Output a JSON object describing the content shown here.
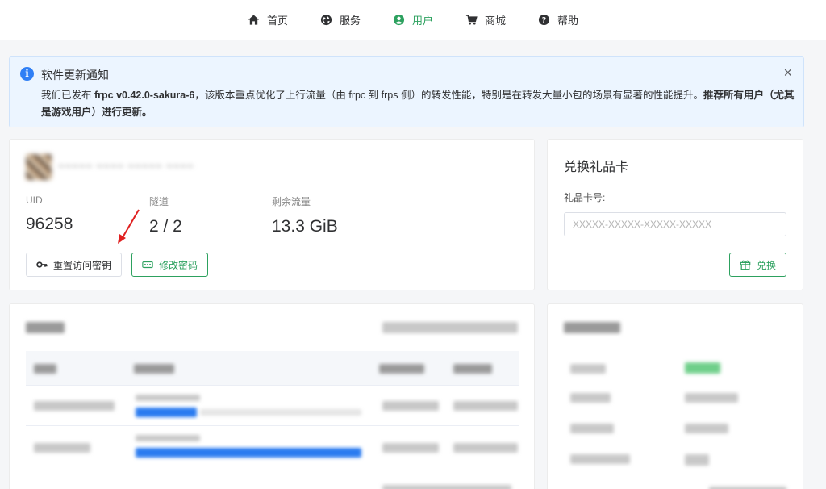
{
  "nav": {
    "items": [
      {
        "label": "首页",
        "icon": "home-icon",
        "active": false
      },
      {
        "label": "服务",
        "icon": "globe-icon",
        "active": false
      },
      {
        "label": "用户",
        "icon": "user-circle-icon",
        "active": true
      },
      {
        "label": "商城",
        "icon": "cart-icon",
        "active": false
      },
      {
        "label": "帮助",
        "icon": "help-icon",
        "active": false
      }
    ]
  },
  "notice": {
    "title": "软件更新通知",
    "body_prefix": "我们已发布 ",
    "version": "frpc v0.42.0-sakura-6",
    "body_middle": "，该版本重点优化了上行流量（由 frpc 到 frps 侧）的转发性能，特别是在转发大量小包的场景有显著的性能提升。",
    "body_bold": "推荐所有用户（尤其是游戏用户）进行更新。",
    "close": "×"
  },
  "user": {
    "username": "~~~~~ ~~~~ ~~~~~ ~~~~",
    "stats": [
      {
        "label": "UID",
        "value": "96258"
      },
      {
        "label": "隧道",
        "value": "2 / 2"
      },
      {
        "label": "剩余流量",
        "value": "13.3 GiB"
      }
    ],
    "reset_key_label": "重置访问密钥",
    "change_password_label": "修改密码"
  },
  "gift": {
    "title": "兑换礼品卡",
    "field_label": "礼品卡号:",
    "placeholder": "XXXXX-XXXXX-XXXXX-XXXXX",
    "redeem_label": "兑换"
  },
  "colors": {
    "accent": "#2da15f",
    "info": "#2f7ff5",
    "notice_bg": "#ecf5ff"
  }
}
